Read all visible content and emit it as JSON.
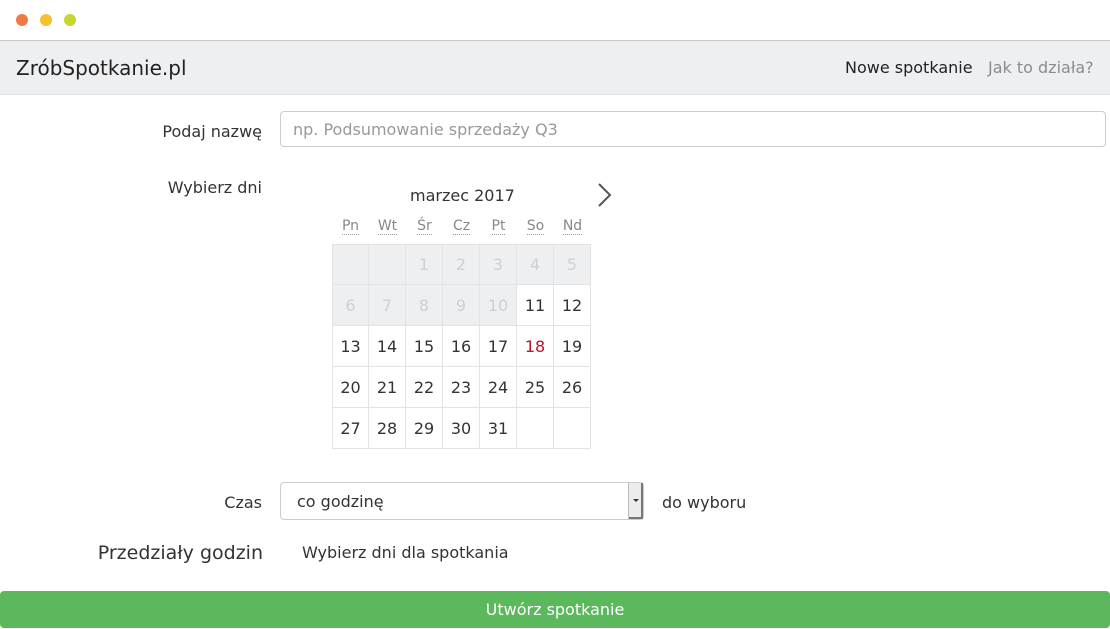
{
  "navbar": {
    "brand": "ZróbSpotkanie.pl",
    "links": [
      {
        "label": "Nowe spotkanie"
      },
      {
        "label": "Jak to działa?"
      }
    ]
  },
  "form": {
    "name_label": "Podaj nazwę",
    "name_placeholder": "np. Podsumowanie sprzedaży Q3",
    "days_label": "Wybierz dni",
    "time_label": "Czas",
    "time_value": "co godzinę",
    "time_suffix": "do wyboru",
    "intervals_label": "Przedziały godzin",
    "intervals_text": "Wybierz dni dla spotkania",
    "submit_label": "Utwórz spotkanie"
  },
  "calendar": {
    "month_label": "marzec 2017",
    "weekdays": [
      "Pn",
      "Wt",
      "Śr",
      "Cz",
      "Pt",
      "So",
      "Nd"
    ],
    "today": 18,
    "weeks": [
      [
        "",
        "",
        "1",
        "2",
        "3",
        "4",
        "5"
      ],
      [
        "6",
        "7",
        "8",
        "9",
        "10",
        "11",
        "12"
      ],
      [
        "13",
        "14",
        "15",
        "16",
        "17",
        "18",
        "19"
      ],
      [
        "20",
        "21",
        "22",
        "23",
        "24",
        "25",
        "26"
      ],
      [
        "27",
        "28",
        "29",
        "30",
        "31",
        "",
        ""
      ]
    ],
    "disabled_through": 10
  },
  "icons": {
    "next_month": "chevron-right-icon",
    "select_arrow": "caret-down-icon"
  },
  "colors": {
    "accent_green": "#5cb85c",
    "today_red": "#c0102a",
    "navbar_bg": "#eeeff1"
  }
}
